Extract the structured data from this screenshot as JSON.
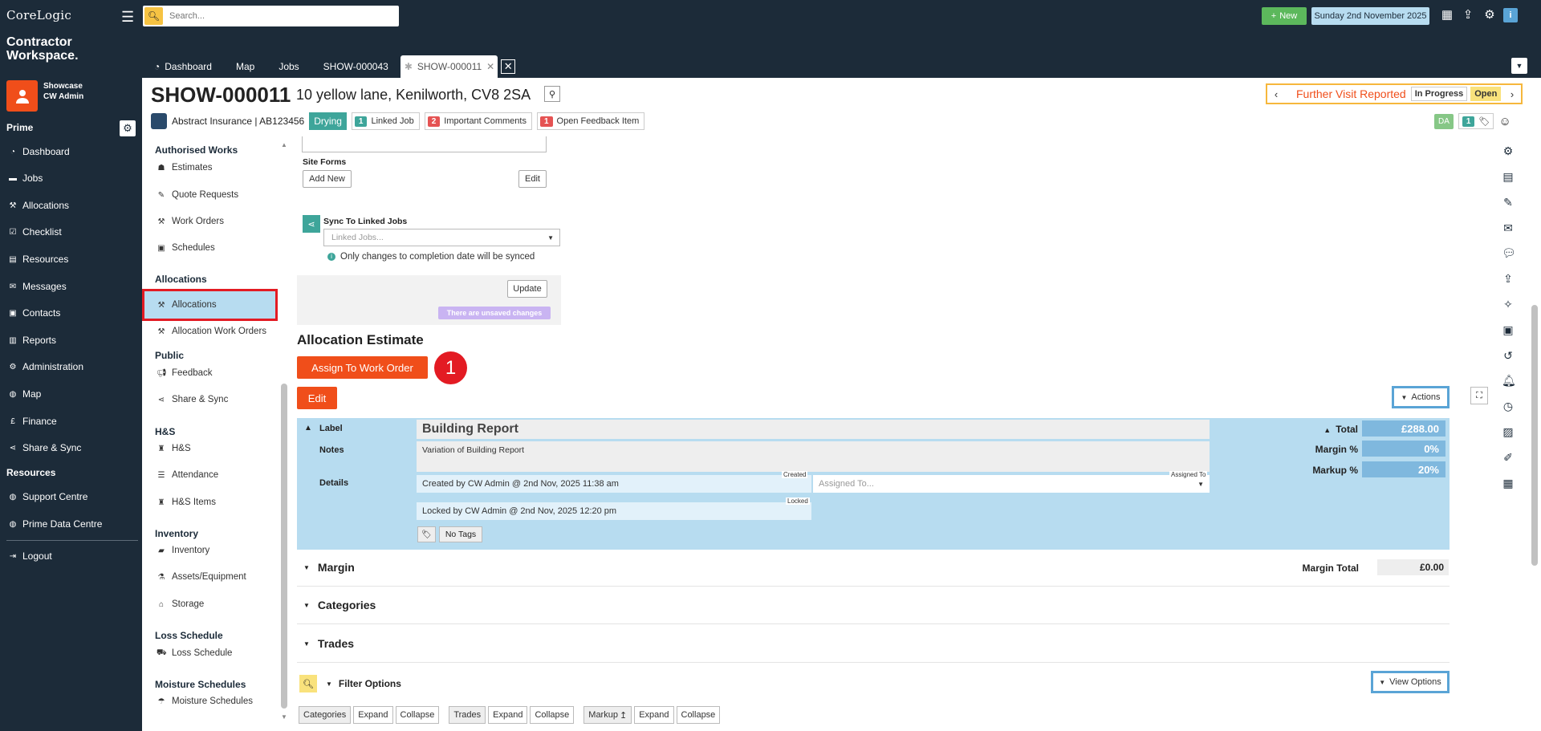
{
  "brand": {
    "name": "CoreLogic",
    "product": "Contractor Workspace."
  },
  "user": {
    "org": "Showcase",
    "name": "CW Admin"
  },
  "sidebar": {
    "section_prime": "Prime",
    "items": [
      {
        "label": "Dashboard",
        "icon": "dashboard-icon"
      },
      {
        "label": "Jobs",
        "icon": "folder-icon"
      },
      {
        "label": "Allocations",
        "icon": "wrench-icon"
      },
      {
        "label": "Checklist",
        "icon": "checkbox-icon"
      },
      {
        "label": "Resources",
        "icon": "resources-icon"
      },
      {
        "label": "Messages",
        "icon": "envelope-icon"
      },
      {
        "label": "Contacts",
        "icon": "contacts-icon"
      },
      {
        "label": "Reports",
        "icon": "chart-icon"
      },
      {
        "label": "Administration",
        "icon": "gear-icon"
      },
      {
        "label": "Map",
        "icon": "globe-icon"
      },
      {
        "label": "Finance",
        "icon": "pound-icon"
      },
      {
        "label": "Share & Sync",
        "icon": "share-icon"
      }
    ],
    "section_resources": "Resources",
    "resource_items": [
      {
        "label": "Support Centre",
        "icon": "globe-icon"
      },
      {
        "label": "Prime Data Centre",
        "icon": "globe-icon"
      }
    ],
    "logout": "Logout"
  },
  "topbar": {
    "search_placeholder": "Search...",
    "new_label": "New",
    "date": "Sunday 2nd November 2025"
  },
  "tabs": [
    {
      "label": "Dashboard"
    },
    {
      "label": "Map"
    },
    {
      "label": "Jobs"
    },
    {
      "label": "SHOW-000043"
    },
    {
      "label": "SHOW-000011"
    }
  ],
  "job": {
    "id": "SHOW-000011",
    "address": "10 yellow lane, Kenilworth, CV8 2SA",
    "status": "Further Visit Reported",
    "badge1": "In Progress",
    "badge2": "Open",
    "insurer": "Abstract Insurance | AB123456",
    "stage": "Drying",
    "chips": [
      {
        "count": "1",
        "label": "Linked Job",
        "color": "#3ea59a"
      },
      {
        "count": "2",
        "label": "Important Comments",
        "color": "#e55353"
      },
      {
        "count": "1",
        "label": "Open Feedback Item",
        "color": "#e55353"
      }
    ],
    "right_initials": "DA",
    "right_count": "1"
  },
  "subnav": {
    "headings": [
      "Authorised Works",
      "Allocations",
      "Public",
      "H&S",
      "Inventory",
      "Loss Schedule",
      "Moisture Schedules"
    ],
    "items": {
      "estimates": "Estimates",
      "quote_requests": "Quote Requests",
      "work_orders": "Work Orders",
      "schedules": "Schedules",
      "allocations": "Allocations",
      "allocation_work_orders": "Allocation Work Orders",
      "feedback": "Feedback",
      "share_sync": "Share & Sync",
      "hs": "H&S",
      "attendance": "Attendance",
      "hs_items": "H&S Items",
      "inventory": "Inventory",
      "assets": "Assets/Equipment",
      "storage": "Storage",
      "loss_schedule": "Loss Schedule",
      "moisture_schedules": "Moisture Schedules"
    }
  },
  "form": {
    "site_forms": "Site Forms",
    "add_new": "Add New",
    "edit": "Edit",
    "sync_label": "Sync To Linked Jobs",
    "linked_jobs_placeholder": "Linked Jobs...",
    "sync_note": "Only changes to completion date will be synced",
    "update": "Update",
    "unsaved": "There are unsaved changes"
  },
  "estimate": {
    "title": "Allocation Estimate",
    "assign_btn": "Assign To Work Order",
    "step_number": "1",
    "edit_btn": "Edit",
    "actions": "Actions",
    "label_caption": "Label",
    "label_value": "Building Report",
    "notes_caption": "Notes",
    "notes_value": "Variation of Building Report",
    "details_caption": "Details",
    "created": "Created by CW Admin @ 2nd Nov, 2025 11:38 am",
    "created_tag": "Created",
    "assigned_placeholder": "Assigned To...",
    "assigned_tag": "Assigned To",
    "locked": "Locked by CW Admin @ 2nd Nov, 2025 12:20 pm",
    "locked_tag": "Locked",
    "no_tags": "No Tags",
    "total_label": "Total",
    "total_value": "£288.00",
    "margin_label": "Margin %",
    "margin_value": "0%",
    "markup_label": "Markup %",
    "markup_value": "20%"
  },
  "sections": {
    "margin": "Margin",
    "margin_total_label": "Margin Total",
    "margin_total_value": "£0.00",
    "categories": "Categories",
    "trades": "Trades",
    "filter_options": "Filter Options",
    "view_options": "View Options"
  },
  "filterbar": {
    "categories": "Categories",
    "trades": "Trades",
    "markup": "Markup",
    "expand": "Expand",
    "collapse": "Collapse"
  },
  "colors": {
    "sidebar": "#1c2b39",
    "accent": "#f04e1a",
    "panel": "#b7dcf0",
    "highlight": "#e31b23"
  }
}
